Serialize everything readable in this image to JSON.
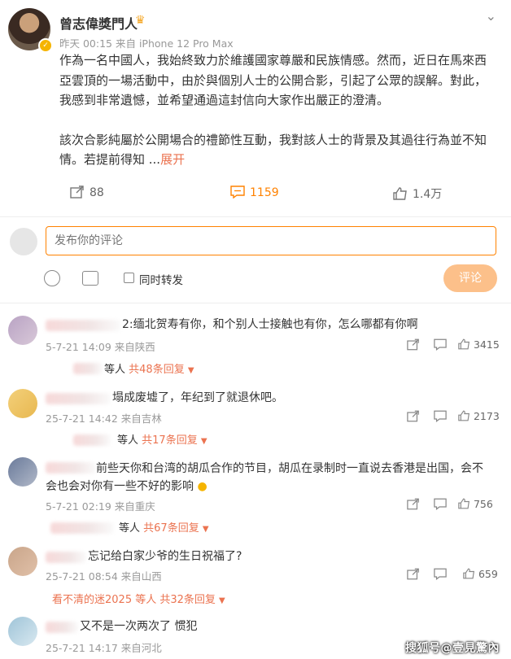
{
  "post": {
    "author": "曾志偉獎門人",
    "time": "昨天 00:15",
    "source": "来自 iPhone 12 Pro Max",
    "paragraph1": "作為一名中國人，我始終致力於維護國家尊嚴和民族情感。然而，近日在馬來西亞雲頂的一場活動中，由於與個別人士的公開合影，引起了公眾的誤解。對此，我感到非常遺憾，並希望通過這封信向大家作出嚴正的澄清。",
    "paragraph2": "該次合影純屬於公開場合的禮節性互動，我對該人士的背景及其過往行為並不知情。若提前得知 ...",
    "expand_label": "展开",
    "reposts": "88",
    "comments": "1159",
    "likes": "1.4万"
  },
  "composer": {
    "placeholder": "发布你的评论",
    "repost_label": "同时转发",
    "submit_label": "评论"
  },
  "comments": [
    {
      "text": "2:缅北贺寿有你，和个别人士接触也有你，怎么哪都有你啊",
      "date": "5-7-21 14:09 来自陕西",
      "likes": "3415",
      "reply_prefix": "等人",
      "reply_count": "共48条回复"
    },
    {
      "text": "塌成废墟了，年纪到了就退休吧。",
      "date": "25-7-21 14:42 来自吉林",
      "likes": "2173",
      "reply_prefix": "等人",
      "reply_count": "共17条回复"
    },
    {
      "text": "前些天你和台湾的胡瓜合作的节目，胡瓜在录制时一直说去香港是出国，会不会也会对你有一些不好的影响",
      "date": "5-7-21 02:19 来自重庆",
      "likes": "756",
      "reply_prefix": "等人",
      "reply_count": "共67条回复"
    },
    {
      "text": "忘记给白家少爷的生日祝福了?",
      "date": "25-7-21 08:54 来自山西",
      "likes": "659",
      "reply_prefix": "看不清的迷2025 等人",
      "reply_count": "共32条回复"
    },
    {
      "text": "又不是一次两次了 惯犯",
      "date": "25-7-21 14:17 来自河北",
      "likes": "",
      "reply_prefix": "",
      "reply_count": ""
    }
  ],
  "watermark": "搜狐号@壹見驚內"
}
